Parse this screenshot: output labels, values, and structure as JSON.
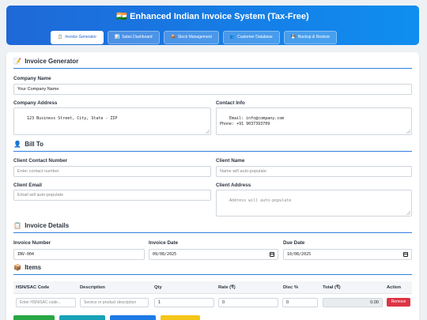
{
  "header": {
    "title": "Enhanced Indian Invoice System (Tax-Free)",
    "flag": "🇮🇳"
  },
  "tabs": [
    {
      "label": "Invoice Generator",
      "icon": "📋",
      "active": true
    },
    {
      "label": "Sales Dashboard",
      "icon": "📊",
      "active": false
    },
    {
      "label": "Stock Management",
      "icon": "📦",
      "active": false
    },
    {
      "label": "Customer Database",
      "icon": "👥",
      "active": false
    },
    {
      "label": "Backup & Restore",
      "icon": "💾",
      "active": false
    }
  ],
  "invoice_generator": {
    "heading": "Invoice Generator",
    "icon": "📝",
    "company_name_label": "Company Name",
    "company_name_value": "Your Company Name",
    "company_address_label": "Company Address",
    "company_address_value": "123 Business Street, City, State - ZIP",
    "contact_info_label": "Contact Info",
    "contact_info_value": "Email: info@company.com\nPhone: +91 9037393709"
  },
  "bill_to": {
    "heading": "Bill To",
    "icon": "👤",
    "client_contact_label": "Client Contact Number",
    "client_contact_placeholder": "Enter contact number",
    "client_name_label": "Client Name",
    "client_name_placeholder": "Name will auto-populate",
    "client_email_label": "Client Email",
    "client_email_placeholder": "Email will auto-populate",
    "client_address_label": "Client Address",
    "client_address_placeholder": "Address will auto-populate"
  },
  "invoice_details": {
    "heading": "Invoice Details",
    "icon": "📋",
    "invoice_number_label": "Invoice Number",
    "invoice_number_value": "INV-004",
    "invoice_date_label": "Invoice Date",
    "invoice_date_value": "09/08/2025",
    "due_date_label": "Due Date",
    "due_date_value": "10/08/2025"
  },
  "items": {
    "heading": "Items",
    "icon": "📦",
    "columns": [
      "HSN/SAC Code",
      "Description",
      "Qty",
      "Rate (₹)",
      "Disc %",
      "Total (₹)",
      "Action"
    ],
    "row": {
      "hsn_placeholder": "Enter HSN/SAC code...",
      "description_placeholder": "Service or product description",
      "qty": "1",
      "rate": "0",
      "disc": "0",
      "total": "0.00",
      "action_label": "Remove"
    }
  },
  "colors": {
    "accent": "#2f7fe0",
    "remove": "#dc3545",
    "btn_green": "#28a745",
    "btn_teal": "#17a2b8",
    "btn_blue": "#1e7be6",
    "btn_yellow": "#f5c518"
  }
}
